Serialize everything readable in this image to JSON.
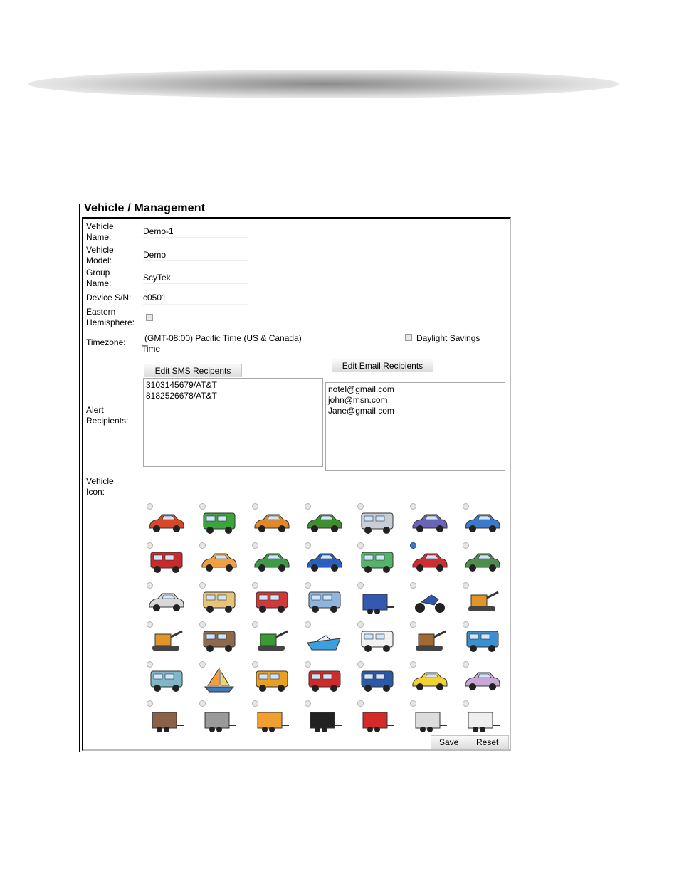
{
  "page_title": "Vehicle / Management",
  "fields": {
    "vehicle_name_label": "Vehicle Name:",
    "vehicle_name": "Demo-1",
    "vehicle_model_label": "Vehicle Model:",
    "vehicle_model": "Demo",
    "group_name_label": "Group Name:",
    "group_name": "ScyTek",
    "device_sn_label": "Device S/N:",
    "device_sn": "c0501",
    "eastern_label": "Eastern Hemisphere:",
    "timezone_label": "Timezone:",
    "timezone_value": "(GMT-08:00) Pacific Time (US & Canada)",
    "timezone_value_2": "Time",
    "daylight_label": "Daylight Savings"
  },
  "alerts": {
    "label": "Alert Recipients:",
    "sms_button": "Edit SMS Recipents",
    "email_button": "Edit Email Recipients",
    "sms_list": [
      "3103145679/AT&T",
      "8182526678/AT&T"
    ],
    "email_list": [
      "notel@gmail.com",
      "john@msn.com",
      "Jane@gmail.com"
    ]
  },
  "icons": {
    "label": "Vehicle Icon:",
    "selected_index": 12,
    "items": [
      {
        "name": "convertible-icon",
        "color": "#d9472b"
      },
      {
        "name": "green-van-icon",
        "color": "#3aa53a"
      },
      {
        "name": "orange-wagon-icon",
        "color": "#e0892a"
      },
      {
        "name": "green-jeep-icon",
        "color": "#3f8f2f"
      },
      {
        "name": "rv-camper-icon",
        "color": "#c9ced6"
      },
      {
        "name": "purple-wagon-icon",
        "color": "#6a64b8"
      },
      {
        "name": "blue-pickup-icon",
        "color": "#3b79c9"
      },
      {
        "name": "semi-truck-icon",
        "color": "#c92b2b"
      },
      {
        "name": "orange-sports-car-icon",
        "color": "#f0a040"
      },
      {
        "name": "green-sedan-icon",
        "color": "#3f9a47"
      },
      {
        "name": "blue-sports-car-icon",
        "color": "#2b5fbf"
      },
      {
        "name": "green-bus-icon",
        "color": "#56b36a"
      },
      {
        "name": "red-suv-icon",
        "color": "#cc2f2f"
      },
      {
        "name": "green-suv-icon",
        "color": "#4d8e4d"
      },
      {
        "name": "limousine-icon",
        "color": "#d8d8d8"
      },
      {
        "name": "tan-minivan-icon",
        "color": "#e8c37a"
      },
      {
        "name": "red-bus-icon",
        "color": "#d23a3a"
      },
      {
        "name": "box-truck-icon",
        "color": "#8fb4dd"
      },
      {
        "name": "blue-trailer-icon",
        "color": "#3459b0"
      },
      {
        "name": "motorcycle-icon",
        "color": "#2f55b0"
      },
      {
        "name": "excavator-icon",
        "color": "#e0952a"
      },
      {
        "name": "bulldozer-icon",
        "color": "#e0952a"
      },
      {
        "name": "dump-truck-icon",
        "color": "#8d6b4a"
      },
      {
        "name": "tractor-icon",
        "color": "#3a9a2f"
      },
      {
        "name": "speedboat-icon",
        "color": "#3aa0e0"
      },
      {
        "name": "ambulance-icon",
        "color": "#f2f2f2"
      },
      {
        "name": "forklift-icon",
        "color": "#a06a30"
      },
      {
        "name": "cement-mixer-icon",
        "color": "#3a8fd0"
      },
      {
        "name": "camper-trailer-icon",
        "color": "#7fb7c9"
      },
      {
        "name": "sailboat-icon",
        "color": "#f0a040"
      },
      {
        "name": "tanker-truck-icon",
        "color": "#e8a020"
      },
      {
        "name": "fire-truck-icon",
        "color": "#d02a2a"
      },
      {
        "name": "blue-semi-icon",
        "color": "#2c58a8"
      },
      {
        "name": "taxi-icon",
        "color": "#f2d230"
      },
      {
        "name": "golf-cart-icon",
        "color": "#c7a6d8"
      },
      {
        "name": "brown-cargo-trailer-icon",
        "color": "#8a6248"
      },
      {
        "name": "gray-cargo-trailer-icon",
        "color": "#9a9a9a"
      },
      {
        "name": "orange-cargo-trailer-icon",
        "color": "#f0a030"
      },
      {
        "name": "black-cargo-trailer-icon",
        "color": "#222222"
      },
      {
        "name": "red-horse-trailer-icon",
        "color": "#d42a2a"
      },
      {
        "name": "white-utility-trailer-icon",
        "color": "#dcdcdc"
      },
      {
        "name": "white-enclosed-trailer-icon",
        "color": "#efefef"
      }
    ]
  },
  "buttons": {
    "save": "Save",
    "reset": "Reset"
  }
}
